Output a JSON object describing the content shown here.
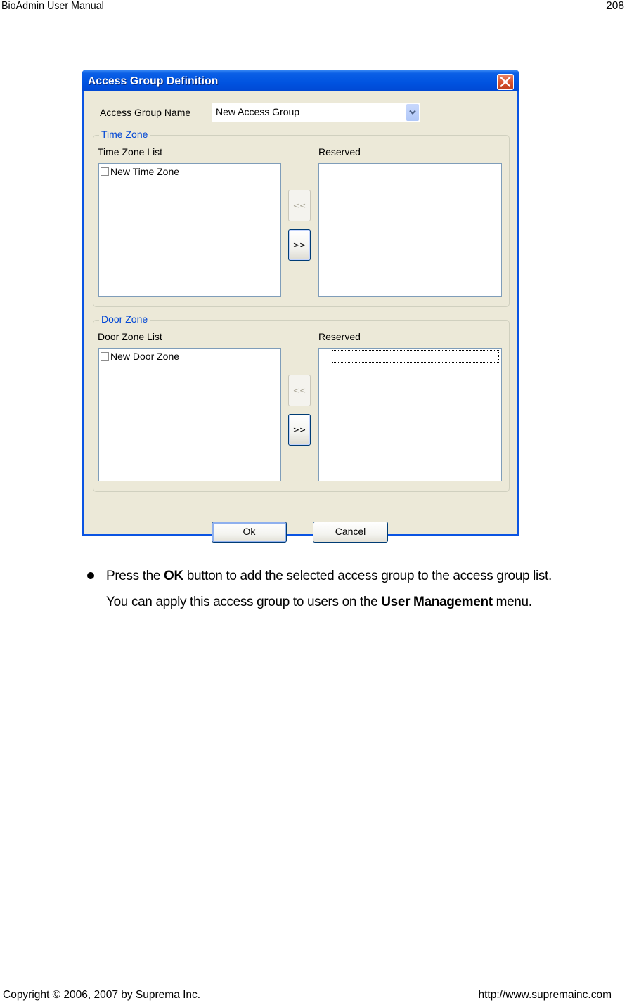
{
  "page_header": {
    "title": "BioAdmin  User  Manual",
    "page_number": "208"
  },
  "dialog": {
    "title": "Access Group Definition",
    "close_icon": "close-icon",
    "access_group_name_label": "Access Group Name",
    "access_group_name_value": "New Access Group",
    "time_zone": {
      "legend": "Time Zone",
      "list_label": "Time Zone List",
      "list_items": [
        "New Time Zone"
      ],
      "reserved_label": "Reserved",
      "reserved_items": [],
      "remove_button": "<<",
      "add_button": ">>"
    },
    "door_zone": {
      "legend": "Door Zone",
      "list_label": "Door Zone List",
      "list_items": [
        "New Door Zone"
      ],
      "reserved_label": "Reserved",
      "reserved_items": [],
      "remove_button": "<<",
      "add_button": ">>"
    },
    "ok_button": "Ok",
    "cancel_button": "Cancel"
  },
  "body": {
    "line1_pre": "Press the ",
    "line1_bold": "OK",
    "line1_post": " button to add the selected access group to the access group list.",
    "line2_pre": "You can apply this access group to users on the ",
    "line2_bold": "User Management",
    "line2_post": " menu."
  },
  "page_footer": {
    "copyright": "Copyright © 2006, 2007 by Suprema Inc.",
    "url": "http://www.supremainc.com"
  }
}
